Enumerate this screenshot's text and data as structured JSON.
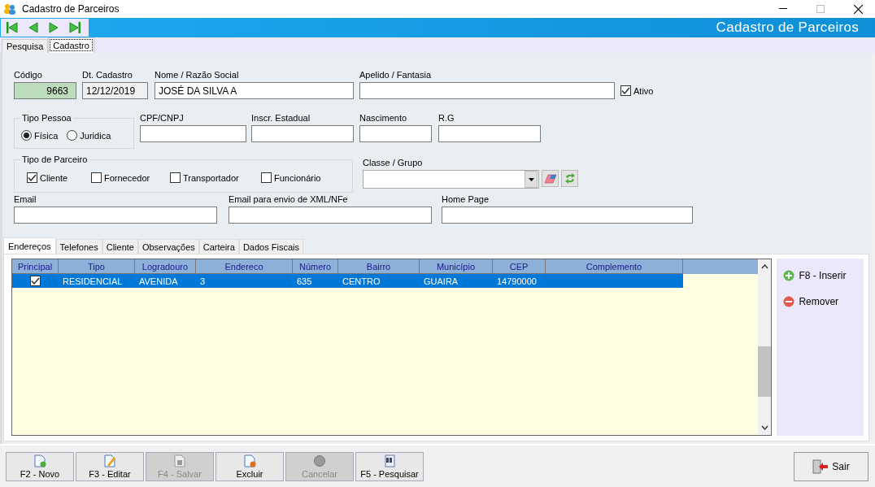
{
  "window": {
    "title": "Cadastro de Parceiros"
  },
  "header_title": "Cadastro de Parceiros",
  "top_tabs": [
    {
      "label": "Pesquisa",
      "selected": false
    },
    {
      "label": "Cadastro",
      "selected": true
    }
  ],
  "row1": [
    {
      "label": "Código",
      "value": "9663",
      "kind": "code"
    },
    {
      "label": "Dt. Cadastro",
      "value": "12/12/2019",
      "kind": "readonly"
    },
    {
      "label": "Nome / Razão Social",
      "value": "JOSÉ DA SILVA A",
      "kind": "text"
    },
    {
      "label": "Apelido / Fantasia",
      "kind": "text"
    }
  ],
  "ativo": {
    "label": "Ativo",
    "checked": true
  },
  "tipo_pessoa": {
    "title": "Tipo Pessoa",
    "options": [
      {
        "label": "Física",
        "selected": true
      },
      {
        "label": "Juridica",
        "selected": false
      }
    ]
  },
  "row2": [
    {
      "label": "CPF/CNPJ"
    },
    {
      "label": "Inscr. Estadual"
    },
    {
      "label": "Nascimento"
    },
    {
      "label": "R.G"
    }
  ],
  "tipo_parceiro": {
    "title": "Tipo de Parceiro",
    "options": [
      {
        "label": "Cliente",
        "checked": true
      },
      {
        "label": "Fornecedor",
        "checked": false
      },
      {
        "label": "Transportador",
        "checked": false
      },
      {
        "label": "Funcionário",
        "checked": false
      }
    ]
  },
  "classe_grupo": {
    "label": "Classe / Grupo"
  },
  "row4": [
    {
      "label": "Email"
    },
    {
      "label": "Email para envio de XML/NFe"
    },
    {
      "label": "Home Page"
    }
  ],
  "inner_tabs": [
    {
      "label": "Endereços",
      "selected": true
    },
    {
      "label": "Telefones",
      "selected": false
    },
    {
      "label": "Cliente",
      "selected": false
    },
    {
      "label": "Observações",
      "selected": false
    },
    {
      "label": "Carteira",
      "selected": false
    },
    {
      "label": "Dados Fiscais",
      "selected": false
    }
  ],
  "grid": {
    "columns": [
      "Principal",
      "Tipo",
      "Logradouro",
      "Endereco",
      "Número",
      "Bairro",
      "Município",
      "CEP",
      "Complemento"
    ],
    "rows": [
      {
        "selected": true,
        "principal": true,
        "cells": [
          "",
          "RESIDENCIAL",
          "AVENIDA",
          "3",
          "635",
          "CENTRO",
          "GUAIRA",
          "14790000"
        ]
      }
    ]
  },
  "side_actions": [
    {
      "label": "F8 - Inserir",
      "kind": "add"
    },
    {
      "label": "Remover",
      "kind": "remove"
    }
  ],
  "footer_buttons": [
    {
      "label": "F2 - Novo",
      "kind": "new",
      "disabled": false
    },
    {
      "label": "F3 - Editar",
      "kind": "edit",
      "disabled": false
    },
    {
      "label": "F4 - Salvar",
      "kind": "save",
      "disabled": true
    },
    {
      "label": "Excluir",
      "kind": "delete",
      "disabled": false
    },
    {
      "label": "Cancelar",
      "kind": "cancel",
      "disabled": true
    },
    {
      "label": "F5 - Pesquisar",
      "kind": "search",
      "disabled": false
    }
  ],
  "exit_button": {
    "label": "Sair"
  }
}
